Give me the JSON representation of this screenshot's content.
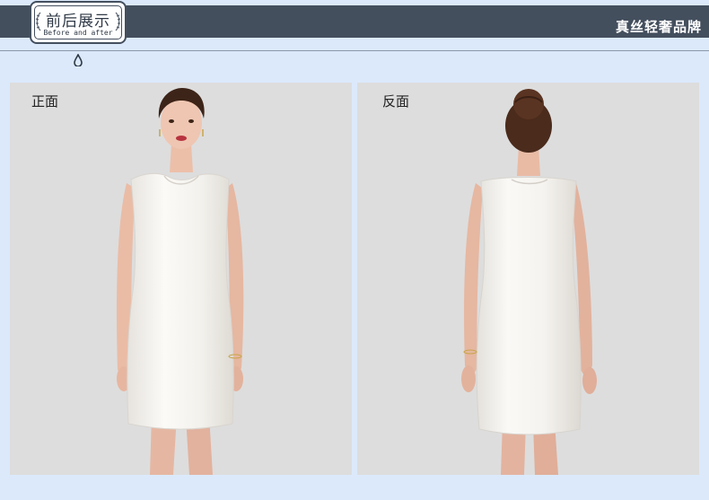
{
  "header": {
    "badge_title": "前后展示",
    "badge_subtitle": "Before and after",
    "brand": "真丝轻奢品牌"
  },
  "panels": {
    "front_label": "正面",
    "back_label": "反面"
  },
  "colors": {
    "bar": "#444f5e",
    "background": "#dbe9fb",
    "panel": "#dddddd",
    "dress": "#f6f4f0"
  },
  "icons": {
    "badge_ornament": "leaf-icon",
    "drop": "drop-icon"
  }
}
